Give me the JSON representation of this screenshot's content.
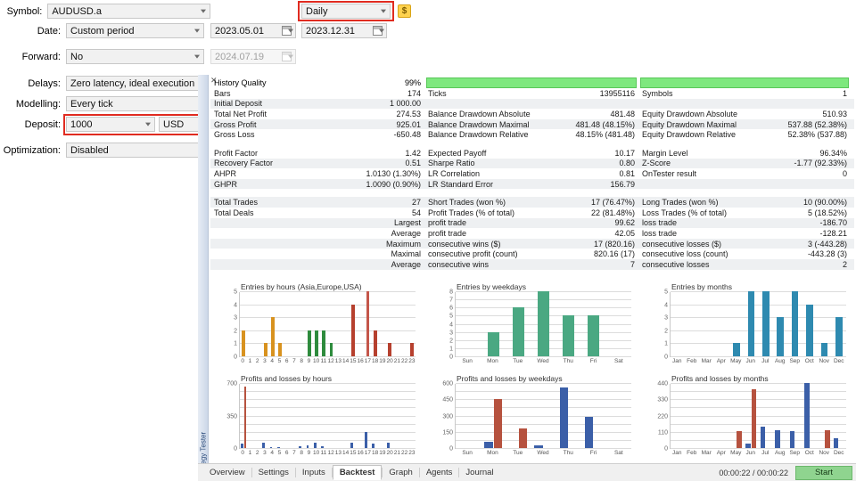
{
  "settings": {
    "rows": [
      {
        "label": "Symbol:",
        "value": "AUDUSD.a",
        "type": "combo",
        "disabled": false
      },
      {
        "label": "Date:",
        "value": "Custom period",
        "type": "combo",
        "disabled": false
      },
      {
        "label": "Forward:",
        "value": "No",
        "type": "combo",
        "disabled": false
      },
      {
        "label": "Delays:",
        "value": "Zero latency, ideal execution",
        "type": "combo",
        "disabled": false
      },
      {
        "label": "Modelling:",
        "value": "Every tick",
        "type": "combo",
        "disabled": false
      },
      {
        "label": "Deposit:",
        "value": "1000",
        "type": "combo",
        "disabled": false
      },
      {
        "label": "Optimization:",
        "value": "Disabled",
        "type": "combo",
        "disabled": false
      }
    ],
    "timeframe": "Daily",
    "date_from": "2023.05.01",
    "date_to": "2023.12.31",
    "forward_date": "2024.07.19",
    "currency": "USD",
    "currency_button": "$"
  },
  "stats": {
    "col1": [
      {
        "k": "History Quality",
        "v": "99%"
      },
      {
        "k": "Bars",
        "v": "174"
      },
      {
        "k": "Initial Deposit",
        "v": "1 000.00"
      },
      {
        "k": "Total Net Profit",
        "v": "274.53"
      },
      {
        "k": "Gross Profit",
        "v": "925.01"
      },
      {
        "k": "Gross Loss",
        "v": "-650.48"
      },
      {
        "k": "",
        "v": ""
      },
      {
        "k": "Profit Factor",
        "v": "1.42"
      },
      {
        "k": "Recovery Factor",
        "v": "0.51"
      },
      {
        "k": "AHPR",
        "v": "1.0130 (1.30%)"
      },
      {
        "k": "GHPR",
        "v": "1.0090 (0.90%)"
      }
    ],
    "col2": [
      {
        "k": "",
        "v": ""
      },
      {
        "k": "Ticks",
        "v": "13955116"
      },
      {
        "k": "",
        "v": ""
      },
      {
        "k": "Balance Drawdown Absolute",
        "v": "481.48"
      },
      {
        "k": "Balance Drawdown Maximal",
        "v": "481.48 (48.15%)"
      },
      {
        "k": "Balance Drawdown Relative",
        "v": "48.15% (481.48)"
      },
      {
        "k": "",
        "v": ""
      },
      {
        "k": "Expected Payoff",
        "v": "10.17"
      },
      {
        "k": "Sharpe Ratio",
        "v": "0.80"
      },
      {
        "k": "LR Correlation",
        "v": "0.81"
      },
      {
        "k": "LR Standard Error",
        "v": "156.79"
      }
    ],
    "col3": [
      {
        "k": "",
        "v": ""
      },
      {
        "k": "Symbols",
        "v": "1"
      },
      {
        "k": "",
        "v": ""
      },
      {
        "k": "Equity Drawdown Absolute",
        "v": "510.93"
      },
      {
        "k": "Equity Drawdown Maximal",
        "v": "537.88 (52.38%)"
      },
      {
        "k": "Equity Drawdown Relative",
        "v": "52.38% (537.88)"
      },
      {
        "k": "",
        "v": ""
      },
      {
        "k": "Margin Level",
        "v": "96.34%"
      },
      {
        "k": "Z-Score",
        "v": "-1.77 (92.33%)"
      },
      {
        "k": "OnTester result",
        "v": "0"
      },
      {
        "k": "",
        "v": ""
      }
    ],
    "trades_col1": [
      {
        "k": "Total Trades",
        "v": "27"
      },
      {
        "k": "Total Deals",
        "v": "54"
      },
      {
        "k": "",
        "v": "Largest"
      },
      {
        "k": "",
        "v": "Average"
      },
      {
        "k": "",
        "v": "Maximum"
      },
      {
        "k": "",
        "v": "Maximal"
      },
      {
        "k": "",
        "v": "Average"
      }
    ],
    "trades_col2": [
      {
        "k": "Short Trades (won %)",
        "v": "17 (76.47%)"
      },
      {
        "k": "Profit Trades (% of total)",
        "v": "22 (81.48%)"
      },
      {
        "k": "profit trade",
        "v": "99.62"
      },
      {
        "k": "profit trade",
        "v": "42.05"
      },
      {
        "k": "consecutive wins ($)",
        "v": "17 (820.16)"
      },
      {
        "k": "consecutive profit (count)",
        "v": "820.16 (17)"
      },
      {
        "k": "consecutive wins",
        "v": "7"
      }
    ],
    "trades_col3": [
      {
        "k": "Long Trades (won %)",
        "v": "10 (90.00%)"
      },
      {
        "k": "Loss Trades (% of total)",
        "v": "5 (18.52%)"
      },
      {
        "k": "loss trade",
        "v": "-186.70"
      },
      {
        "k": "loss trade",
        "v": "-128.21"
      },
      {
        "k": "consecutive losses ($)",
        "v": "3 (-443.28)"
      },
      {
        "k": "consecutive loss (count)",
        "v": "-443.28 (3)"
      },
      {
        "k": "consecutive losses",
        "v": "2"
      }
    ]
  },
  "chart_data": [
    {
      "id": "entries-by-hours",
      "type": "bar",
      "title": "Entries by hours (Asia,Europe,USA)",
      "xlabel": "",
      "ylabel": "",
      "ylim": [
        0,
        5
      ],
      "yticks": [
        0,
        1,
        2,
        3,
        4,
        5
      ],
      "grid": true,
      "categories": [
        "0",
        "1",
        "2",
        "3",
        "4",
        "5",
        "6",
        "7",
        "8",
        "9",
        "10",
        "11",
        "12",
        "13",
        "14",
        "15",
        "16",
        "17",
        "18",
        "19",
        "20",
        "21",
        "22",
        "23"
      ],
      "values": [
        2,
        0,
        0,
        1,
        3,
        1,
        0,
        0,
        0,
        2,
        2,
        2,
        1,
        0,
        0,
        4,
        0,
        5,
        2,
        0,
        1,
        0,
        0,
        1
      ],
      "bar_colors": [
        "#d8921f",
        "#d8921f",
        "#d8921f",
        "#d8921f",
        "#d8921f",
        "#d8921f",
        "#d8921f",
        "#d8921f",
        "#d8921f",
        "#2e8b3d",
        "#2e8b3d",
        "#2e8b3d",
        "#2e8b3d",
        "#2e8b3d",
        "#2e8b3d",
        "#b6402e",
        "#b6402e",
        "#c4564a",
        "#b6402e",
        "#b6402e",
        "#b6402e",
        "#b6402e",
        "#b6402e",
        "#b6402e"
      ],
      "legend": [
        "Asia",
        "Europe",
        "USA"
      ]
    },
    {
      "id": "entries-by-weekdays",
      "type": "bar",
      "title": "Entries by weekdays",
      "xlabel": "",
      "ylabel": "",
      "ylim": [
        0,
        8
      ],
      "yticks": [
        0,
        1,
        2,
        3,
        4,
        5,
        6,
        7,
        8
      ],
      "grid": true,
      "categories": [
        "Sun",
        "Mon",
        "Tue",
        "Wed",
        "Thu",
        "Fri",
        "Sat"
      ],
      "values": [
        0,
        3,
        6,
        8,
        5,
        5,
        0
      ],
      "bar_color": "#4aa882"
    },
    {
      "id": "entries-by-months",
      "type": "bar",
      "title": "Entries by months",
      "xlabel": "",
      "ylabel": "",
      "ylim": [
        0,
        5
      ],
      "yticks": [
        0,
        1,
        2,
        3,
        4,
        5
      ],
      "grid": true,
      "categories": [
        "Jan",
        "Feb",
        "Mar",
        "Apr",
        "May",
        "Jun",
        "Jul",
        "Aug",
        "Sep",
        "Oct",
        "Nov",
        "Dec"
      ],
      "values": [
        0,
        0,
        0,
        0,
        1,
        5,
        5,
        3,
        5,
        4,
        1,
        3
      ],
      "bar_color": "#2e8ab0"
    },
    {
      "id": "profits-losses-by-hours",
      "type": "bar",
      "title": "Profits and losses by hours",
      "xlabel": "",
      "ylabel": "",
      "ylim": [
        0,
        700
      ],
      "yticks": [
        0,
        350,
        700
      ],
      "grid": true,
      "categories": [
        "0",
        "1",
        "2",
        "3",
        "4",
        "5",
        "6",
        "7",
        "8",
        "9",
        "10",
        "11",
        "12",
        "13",
        "14",
        "15",
        "16",
        "17",
        "18",
        "19",
        "20",
        "21",
        "22",
        "23"
      ],
      "series": [
        {
          "name": "profit",
          "color": "#3b5fa8",
          "values": [
            45,
            0,
            0,
            62,
            14,
            8,
            0,
            0,
            22,
            30,
            55,
            18,
            0,
            0,
            0,
            55,
            0,
            170,
            48,
            0,
            60,
            0,
            0,
            0
          ]
        },
        {
          "name": "loss",
          "color": "#b6523f",
          "values": [
            660,
            0,
            0,
            0,
            0,
            0,
            0,
            0,
            0,
            0,
            0,
            0,
            0,
            0,
            0,
            0,
            0,
            0,
            0,
            0,
            0,
            0,
            0,
            0
          ]
        }
      ]
    },
    {
      "id": "profits-losses-by-weekdays",
      "type": "bar",
      "title": "Profits and losses by weekdays",
      "xlabel": "",
      "ylabel": "",
      "ylim": [
        0,
        600
      ],
      "yticks": [
        0,
        150,
        300,
        450,
        600
      ],
      "grid": true,
      "categories": [
        "Sun",
        "Mon",
        "Tue",
        "Wed",
        "Thu",
        "Fri",
        "Sat"
      ],
      "series": [
        {
          "name": "profit",
          "color": "#3b5fa8",
          "values": [
            0,
            55,
            0,
            25,
            560,
            290,
            0
          ]
        },
        {
          "name": "loss",
          "color": "#b6523f",
          "values": [
            0,
            455,
            185,
            0,
            0,
            0,
            0
          ]
        }
      ]
    },
    {
      "id": "profits-losses-by-months",
      "type": "bar",
      "title": "Profits and losses by months",
      "xlabel": "",
      "ylabel": "",
      "ylim": [
        0,
        440
      ],
      "yticks": [
        0,
        110,
        220,
        330,
        440
      ],
      "grid": true,
      "categories": [
        "Jan",
        "Feb",
        "Mar",
        "Apr",
        "May",
        "Jun",
        "Jul",
        "Aug",
        "Sep",
        "Oct",
        "Nov",
        "Dec"
      ],
      "series": [
        {
          "name": "profit",
          "color": "#3b5fa8",
          "values": [
            0,
            0,
            0,
            0,
            0,
            32,
            145,
            120,
            112,
            440,
            0,
            68
          ]
        },
        {
          "name": "loss",
          "color": "#b6523f",
          "values": [
            0,
            0,
            0,
            0,
            112,
            400,
            0,
            0,
            0,
            0,
            122,
            0
          ]
        }
      ]
    }
  ],
  "vertical_tab": "Strategy Tester",
  "tabs": [
    {
      "label": "Overview",
      "active": false
    },
    {
      "label": "Settings",
      "active": false
    },
    {
      "label": "Inputs",
      "active": false
    },
    {
      "label": "Backtest",
      "active": true
    },
    {
      "label": "Graph",
      "active": false
    },
    {
      "label": "Agents",
      "active": false
    },
    {
      "label": "Journal",
      "active": false
    }
  ],
  "status": {
    "timer": "00:00:22 / 00:00:22",
    "start_label": "Start"
  }
}
